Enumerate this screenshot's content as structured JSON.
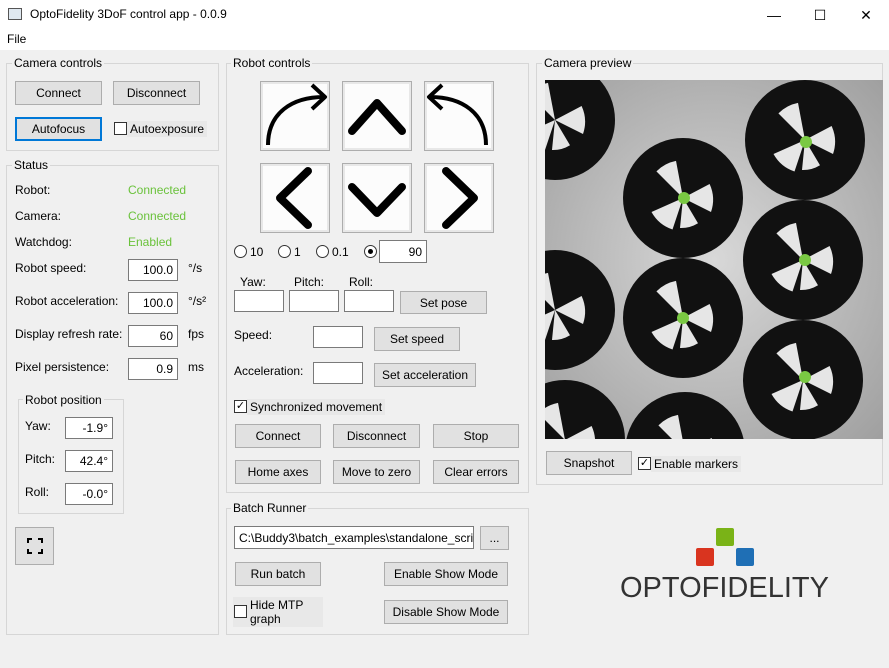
{
  "window": {
    "title": "OptoFidelity 3DoF control app - 0.0.9",
    "minimize": "—",
    "maximize": "☐",
    "close": "✕"
  },
  "menu": {
    "file": "File"
  },
  "camera_controls": {
    "title": "Camera controls",
    "connect": "Connect",
    "disconnect": "Disconnect",
    "autofocus": "Autofocus",
    "autoexposure": "Autoexposure",
    "autoexposure_checked": false
  },
  "status": {
    "title": "Status",
    "robot_label": "Robot:",
    "robot_value": "Connected",
    "camera_label": "Camera:",
    "camera_value": "Connected",
    "watchdog_label": "Watchdog:",
    "watchdog_value": "Enabled",
    "speed_label": "Robot speed:",
    "speed_value": "100.0",
    "speed_unit": "°/s",
    "accel_label": "Robot acceleration:",
    "accel_value": "100.0",
    "accel_unit": "°/s²",
    "refresh_label": "Display refresh rate:",
    "refresh_value": "60",
    "refresh_unit": "fps",
    "persist_label": "Pixel persistence:",
    "persist_value": "0.9",
    "persist_unit": "ms"
  },
  "robot_position": {
    "title": "Robot position",
    "yaw_label": "Yaw:",
    "yaw_value": "-1.9°",
    "pitch_label": "Pitch:",
    "pitch_value": "42.4°",
    "roll_label": "Roll:",
    "roll_value": "-0.0°"
  },
  "robot_controls": {
    "title": "Robot controls",
    "step_options": [
      "10",
      "1",
      "0.1"
    ],
    "custom_step": "90",
    "selected_step": "custom",
    "yaw_label": "Yaw:",
    "pitch_label": "Pitch:",
    "roll_label": "Roll:",
    "set_pose": "Set pose",
    "speed_label": "Speed:",
    "set_speed": "Set speed",
    "accel_label": "Acceleration:",
    "set_accel": "Set acceleration",
    "sync_label": "Synchronized movement",
    "sync_checked": true,
    "connect": "Connect",
    "disconnect": "Disconnect",
    "stop": "Stop",
    "home": "Home axes",
    "move_zero": "Move to zero",
    "clear_errors": "Clear errors"
  },
  "batch_runner": {
    "title": "Batch Runner",
    "path": "C:\\Buddy3\\batch_examples\\standalone_scri",
    "browse": "...",
    "run": "Run batch",
    "enable_show": "Enable Show Mode",
    "disable_show": "Disable Show Mode",
    "hide_mtp": "Hide MTP graph",
    "hide_mtp_checked": false
  },
  "camera_preview": {
    "title": "Camera preview",
    "snapshot": "Snapshot",
    "enable_markers": "Enable markers",
    "markers_checked": true,
    "marker_color": "#7ac943"
  },
  "logo": {
    "text": "OPTOFIDELITY",
    "colors": [
      "#7ab317",
      "#d9341f",
      "#1f6fb5"
    ]
  },
  "icons": {
    "fullscreen": "fullscreen-icon"
  }
}
